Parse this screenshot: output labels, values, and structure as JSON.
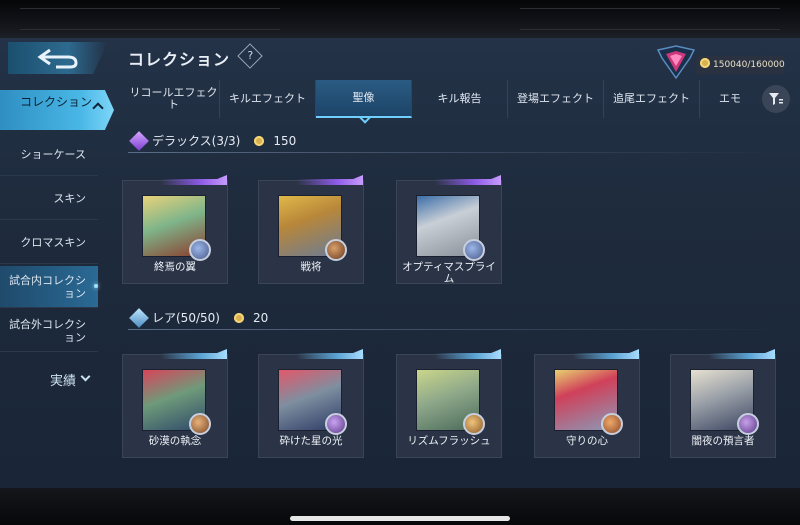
{
  "header": {
    "title": "コレクション",
    "help_glyph": "?",
    "points": "150040/160000"
  },
  "sidebar": {
    "collection": "コレクション",
    "items": [
      {
        "label": "ショーケース"
      },
      {
        "label": "スキン"
      },
      {
        "label": "クロマスキン"
      },
      {
        "label": "試合内コレクション"
      },
      {
        "label": "試合外コレクション"
      }
    ],
    "achievements": "実績"
  },
  "tabs": [
    "リコールエフェクト",
    "キルエフェクト",
    "聖像",
    "キル報告",
    "登場エフェクト",
    "追尾エフェクト",
    "エモ"
  ],
  "sections": {
    "deluxe": {
      "title": "デラックス(3/3)",
      "points": "150",
      "cards": [
        {
          "name": "終焉の翼"
        },
        {
          "name": "戦将"
        },
        {
          "name": "オプティマスプライム"
        }
      ]
    },
    "rare": {
      "title": "レア(50/50)",
      "points": "20",
      "cards": [
        {
          "name": "砂漠の執念"
        },
        {
          "name": "砕けた星の光"
        },
        {
          "name": "リズムフラッシュ"
        },
        {
          "name": "守りの心"
        },
        {
          "name": "闇夜の預言者"
        }
      ]
    }
  },
  "colors": {
    "accent": "#48b7e6",
    "deluxe": "#8d5be6",
    "rare": "#5aa2d2",
    "background": "#1e2b3d"
  },
  "icons": [
    "back-arrow-icon",
    "help-icon",
    "rank-emblem-icon",
    "coin-icon",
    "filter-icon",
    "chevron-up-icon",
    "chevron-down-icon",
    "deluxe-gem-icon",
    "rare-gem-icon"
  ]
}
